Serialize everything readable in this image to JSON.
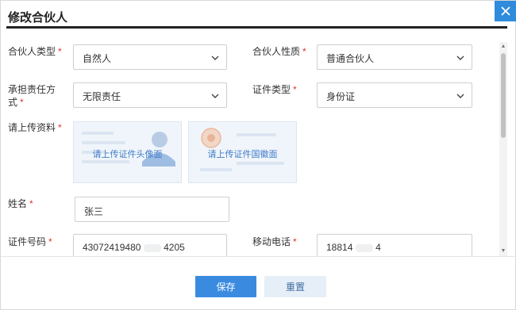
{
  "dialog": {
    "title": "修改合伙人"
  },
  "form": {
    "partner_type": {
      "label": "合伙人类型",
      "value": "自然人"
    },
    "partner_nature": {
      "label": "合伙人性质",
      "value": "普通合伙人"
    },
    "liability": {
      "label_line1": "承担责任方",
      "label_line2": "式",
      "value": "无限责任"
    },
    "id_type": {
      "label": "证件类型",
      "value": "身份证"
    },
    "upload": {
      "label": "请上传资料",
      "front_text": "请上传证件头像面",
      "back_text": "请上传证件国徽面"
    },
    "name": {
      "label": "姓名",
      "value": "张三"
    },
    "id_number": {
      "label": "证件号码",
      "value_start": "43072419480",
      "value_end": "4205"
    },
    "mobile": {
      "label": "移动电话",
      "value_start": "18814",
      "value_end": "4"
    },
    "required_mark": "*"
  },
  "footer": {
    "save_label": "保存",
    "reset_label": "重置"
  },
  "icons": {
    "close": "close-icon",
    "dropdown": "chevron-down-icon"
  },
  "colors": {
    "accent": "#3a8be0",
    "required": "#e0342c",
    "close_bg": "#2f8bdc"
  }
}
